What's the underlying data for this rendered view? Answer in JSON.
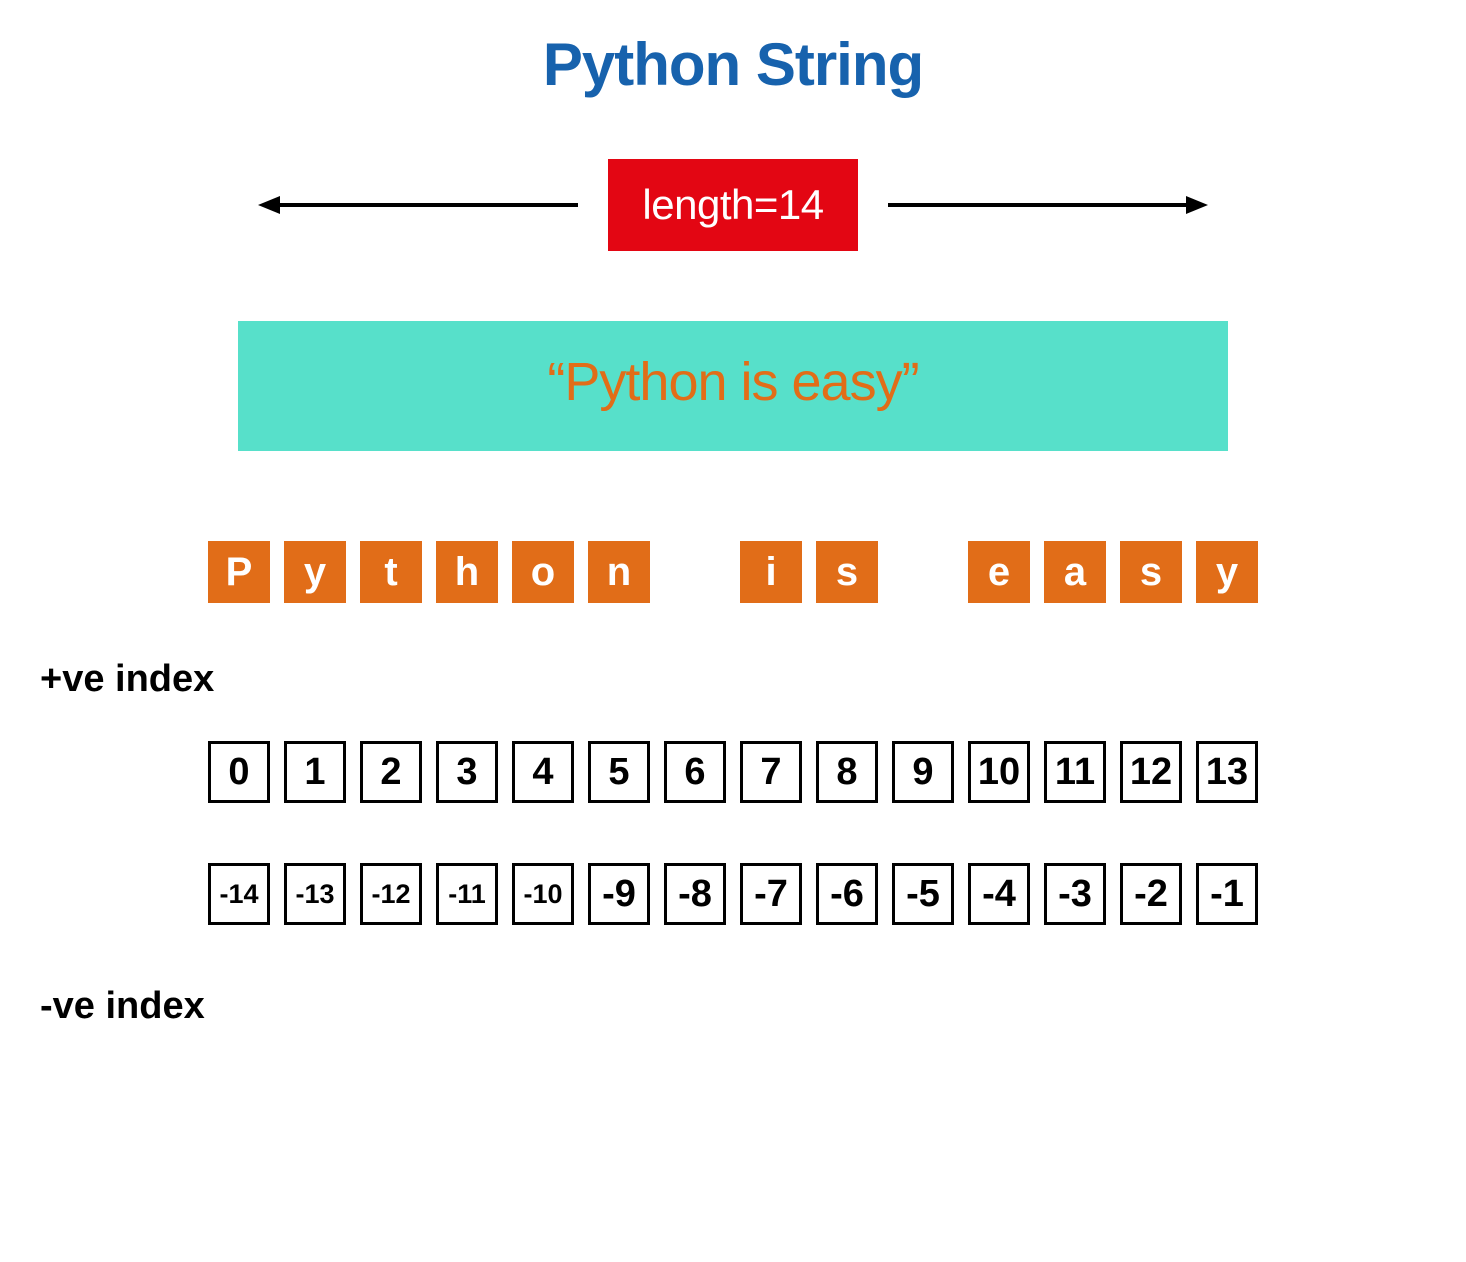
{
  "title": "Python String",
  "length_label": "length=14",
  "string_display": "“Python is easy”",
  "chars": [
    "P",
    "y",
    "t",
    "h",
    "o",
    "n",
    " ",
    "i",
    "s",
    " ",
    "e",
    "a",
    "s",
    "y"
  ],
  "pos_index_label": "+ve index",
  "pos_indices": [
    "0",
    "1",
    "2",
    "3",
    "4",
    "5",
    "6",
    "7",
    "8",
    "9",
    "10",
    "11",
    "12",
    "13"
  ],
  "neg_index_label": "-ve index",
  "neg_indices": [
    "-14",
    "-13",
    "-12",
    "-11",
    "-10",
    "-9",
    "-8",
    "-7",
    "-6",
    "-5",
    "-4",
    "-3",
    "-2",
    "-1"
  ],
  "colors": {
    "title": "#1762ad",
    "badge_bg": "#e30613",
    "banner_bg": "#57e0ca",
    "accent_orange": "#e16d18"
  }
}
